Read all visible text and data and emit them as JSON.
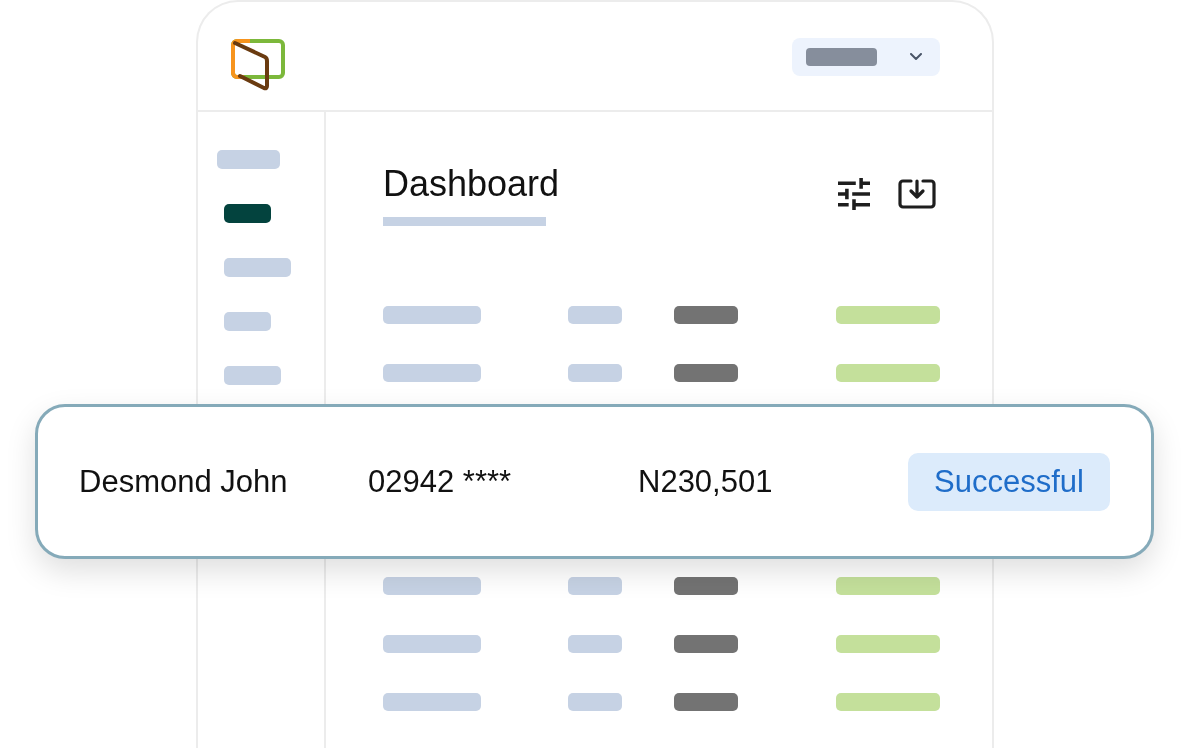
{
  "sidebar": {
    "items": [
      {
        "selected": false
      },
      {
        "selected": true
      },
      {
        "selected": false
      },
      {
        "selected": false
      },
      {
        "selected": false
      }
    ]
  },
  "page": {
    "title": "Dashboard"
  },
  "table": {
    "rows": [
      {
        "kind": "placeholder"
      },
      {
        "kind": "placeholder"
      },
      {
        "kind": "record",
        "name": "Desmond John",
        "account": "02942 ****",
        "amount": "N230,501",
        "status": "Successful"
      },
      {
        "kind": "placeholder"
      },
      {
        "kind": "placeholder"
      },
      {
        "kind": "placeholder"
      }
    ]
  }
}
